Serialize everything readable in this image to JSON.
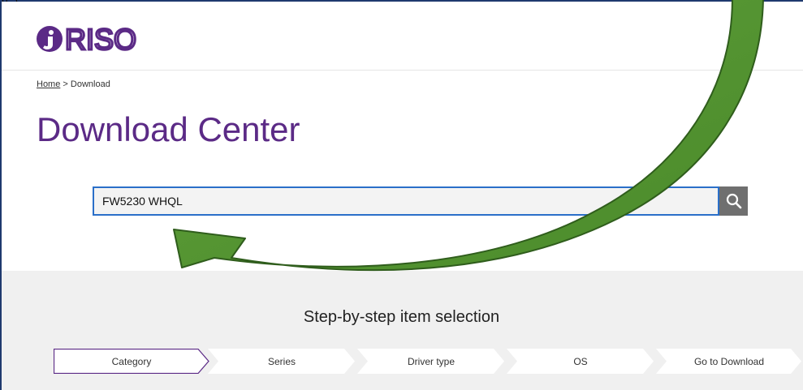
{
  "header": {
    "logo_text": "RISO"
  },
  "breadcrumb": {
    "home": "Home",
    "separator": " > ",
    "current": "Download"
  },
  "page": {
    "title": "Download Center"
  },
  "search": {
    "value": "FW5230 WHQL",
    "icon": "search-icon"
  },
  "steps": {
    "title": "Step-by-step item selection",
    "items": [
      {
        "label": "Category",
        "active": true
      },
      {
        "label": "Series",
        "active": false
      },
      {
        "label": "Driver type",
        "active": false
      },
      {
        "label": "OS",
        "active": false
      },
      {
        "label": "Go to Download",
        "active": false
      }
    ]
  },
  "colors": {
    "brand_purple": "#5b2a86",
    "search_border": "#2a6fc9",
    "annotation_arrow": "#5a9a35"
  },
  "annotation": {
    "type": "green-curved-arrow"
  }
}
